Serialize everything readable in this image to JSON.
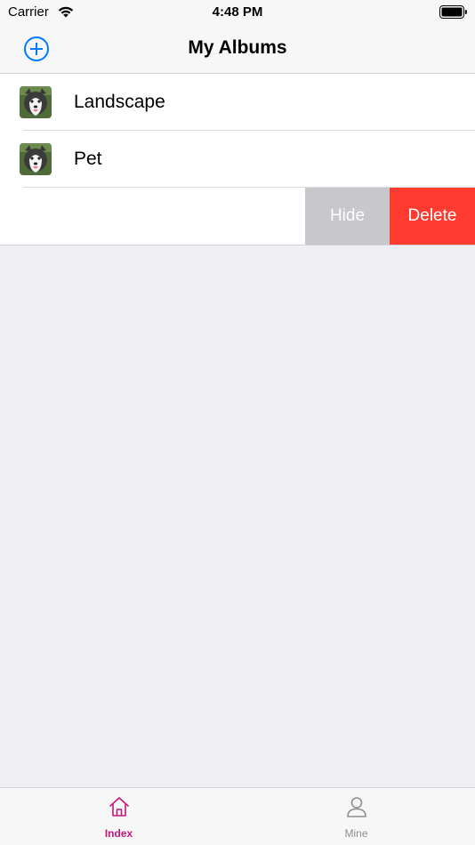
{
  "status_bar": {
    "carrier": "Carrier",
    "time": "4:48 PM"
  },
  "nav_bar": {
    "title": "My Albums",
    "add_icon": "plus-circle-icon"
  },
  "albums": [
    {
      "label": "Landscape",
      "thumbnail": "husky-dog-photo"
    },
    {
      "label": "Pet",
      "thumbnail": "husky-dog-photo"
    }
  ],
  "swipe_actions": {
    "hide_label": "Hide",
    "delete_label": "Delete"
  },
  "tab_bar": {
    "tabs": [
      {
        "label": "Index",
        "icon": "home-icon",
        "selected": true
      },
      {
        "label": "Mine",
        "icon": "person-icon",
        "selected": false
      }
    ]
  },
  "colors": {
    "accent": "#007aff",
    "tab_selected": "#c2187c",
    "tab_unselected": "#8e8e93",
    "hide_action": "#c7c7cc",
    "delete_action": "#ff3b30",
    "background": "#efeff4"
  }
}
